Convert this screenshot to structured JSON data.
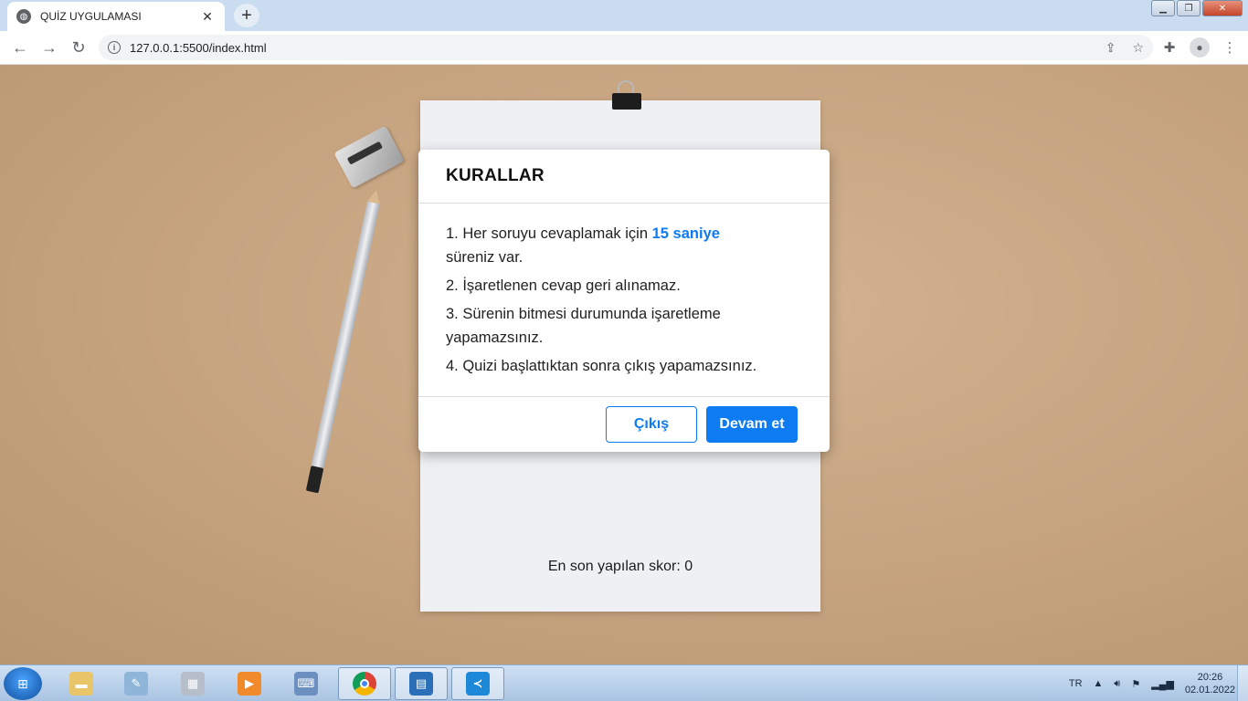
{
  "browser": {
    "tab_title": "QUİZ UYGULAMASI",
    "url": "127.0.0.1:5500/index.html"
  },
  "modal": {
    "title": "KURALLAR",
    "rule1_prefix": "1. Her soruyu cevaplamak için ",
    "rule1_highlight": "15 saniye",
    "rule1_suffix": "süreniz var.",
    "rule2": "2. İşaretlenen cevap geri alınamaz.",
    "rule3": "3. Sürenin bitmesi durumunda işaretleme yapamazsınız.",
    "rule4": "4. Quizi başlattıktan sonra çıkış yapamazsınız.",
    "exit_label": "Çıkış",
    "continue_label": "Devam et"
  },
  "score_text": "En son yapılan skor: 0",
  "taskbar": {
    "language": "TR",
    "time": "20:26",
    "date": "02.01.2022"
  },
  "colors": {
    "accent": "#0d7bf2"
  }
}
